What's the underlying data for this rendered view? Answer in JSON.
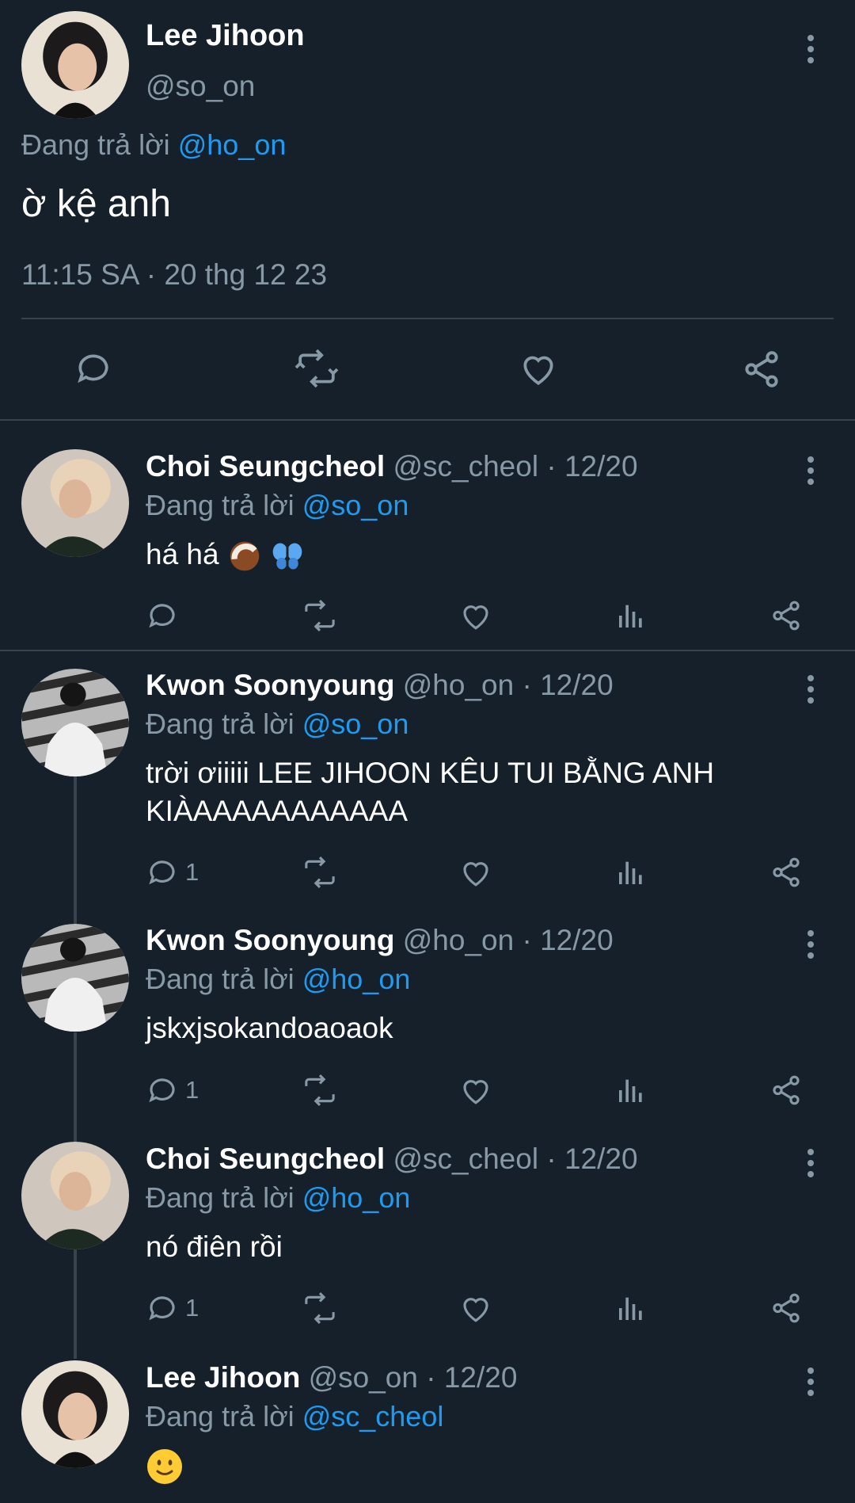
{
  "main_tweet": {
    "name": "Lee Jihoon",
    "handle": "@so_on",
    "replying_prefix": "Đang trả lời",
    "replying_to": "@ho_on",
    "text": "ờ kệ anh",
    "timestamp": "11:15 SA · 20 thg 12 23",
    "avatar_icon": "profile-photo"
  },
  "replies": [
    {
      "name": "Choi Seungcheol",
      "meta": "@sc_cheol · 12/20",
      "replying_prefix": "Đang trả lời",
      "replying_to": "@so_on",
      "text": "há há",
      "emoji": [
        "coconut-emoji",
        "butterfly-emoji"
      ],
      "reply_count": ""
    },
    {
      "name": "Kwon Soonyoung",
      "meta": "@ho_on · 12/20",
      "replying_prefix": "Đang trả lời",
      "replying_to": "@so_on",
      "text_line1": "trời ơiiiii LEE JIHOON KÊU TUI BẰNG ANH",
      "text_line2": "KIÀAAAAAAAAAAA",
      "reply_count": "1"
    },
    {
      "name": "Kwon Soonyoung",
      "meta": "@ho_on · 12/20",
      "replying_prefix": "Đang trả lời",
      "replying_to": "@ho_on",
      "text": "jskxjsokandoaoaok",
      "reply_count": "1"
    },
    {
      "name": "Choi Seungcheol",
      "meta": "@sc_cheol · 12/20",
      "replying_prefix": "Đang trả lời",
      "replying_to": "@ho_on",
      "text": "nó điên rồi",
      "reply_count": "1"
    },
    {
      "name": "Lee Jihoon",
      "meta": "@so_on · 12/20",
      "replying_prefix": "Đang trả lời",
      "replying_to": "@sc_cheol",
      "emoji": [
        "slightly-smiling-face-emoji"
      ]
    }
  ],
  "colors": {
    "background": "#15202b",
    "muted": "#8899a6",
    "link": "#1d9bf0",
    "divider": "#38444d"
  }
}
